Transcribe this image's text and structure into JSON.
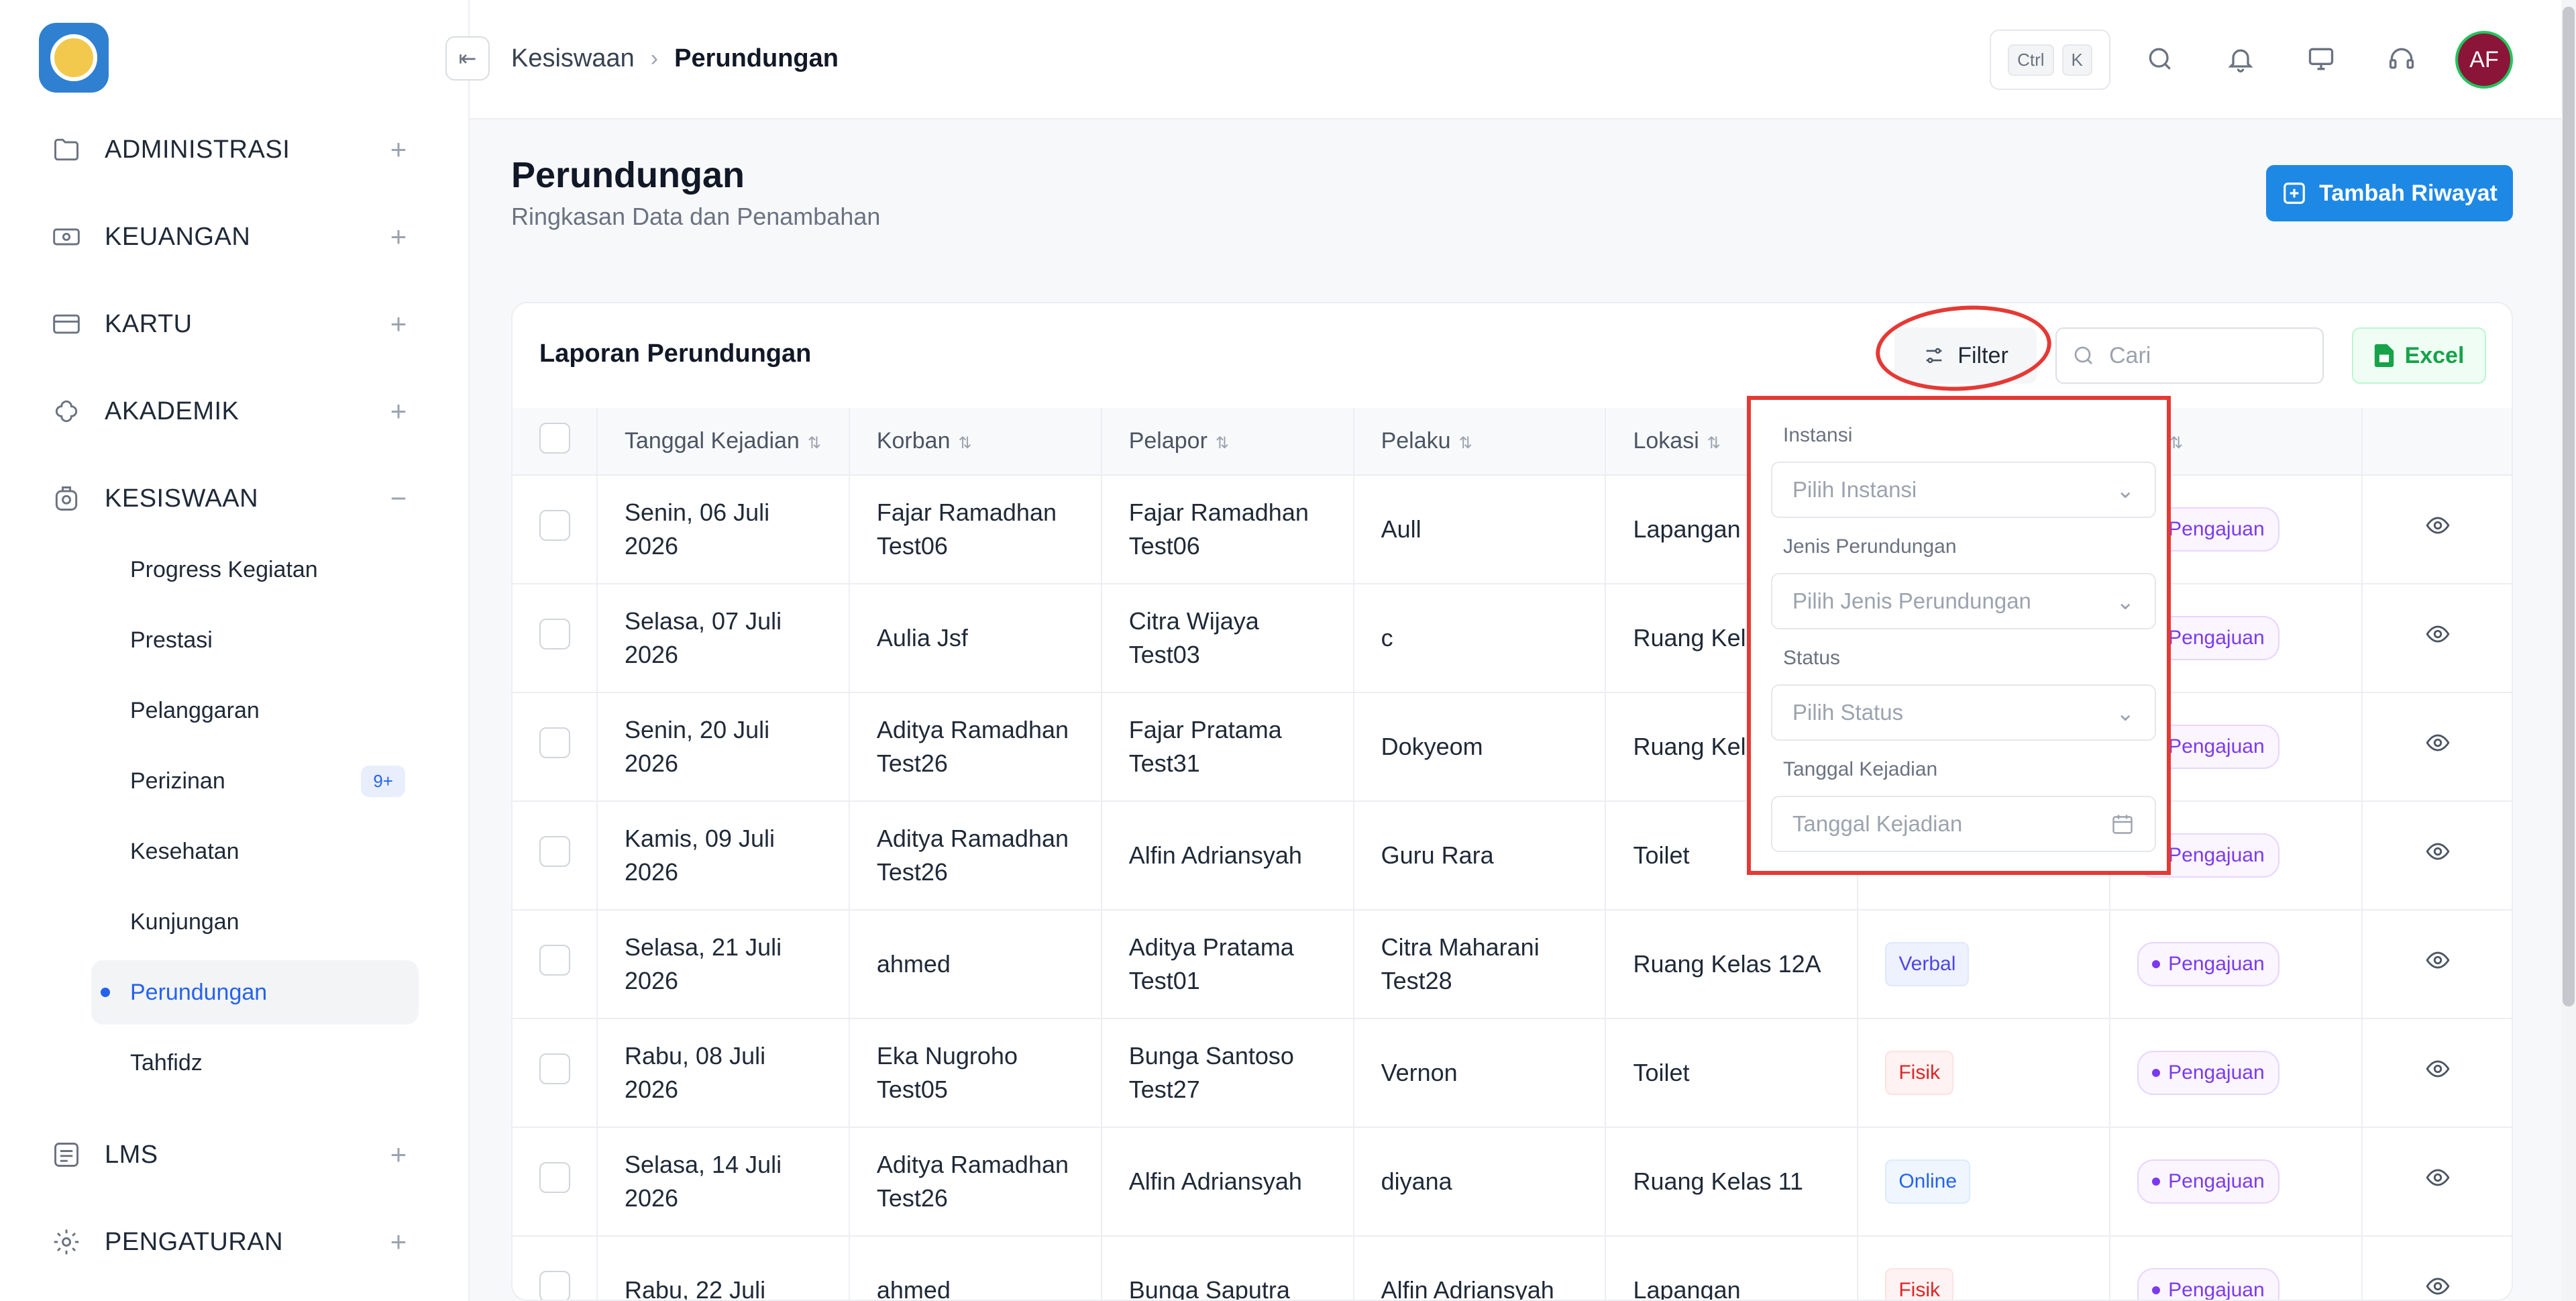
{
  "sidebar": {
    "menu": [
      {
        "label": "ADMINISTRASI",
        "toggle": "+",
        "icon": "folder-icon"
      },
      {
        "label": "KEUANGAN",
        "toggle": "+",
        "icon": "money-icon"
      },
      {
        "label": "KARTU",
        "toggle": "+",
        "icon": "card-icon"
      },
      {
        "label": "AKADEMIK",
        "toggle": "+",
        "icon": "brain-icon"
      },
      {
        "label": "KESISWAAN",
        "toggle": "−",
        "icon": "student-icon"
      }
    ],
    "kesiswaan_items": [
      {
        "label": "Progress Kegiatan"
      },
      {
        "label": "Prestasi"
      },
      {
        "label": "Pelanggaran"
      },
      {
        "label": "Perizinan",
        "badge": "9+"
      },
      {
        "label": "Kesehatan"
      },
      {
        "label": "Kunjungan"
      },
      {
        "label": "Perundungan"
      },
      {
        "label": "Tahfidz"
      }
    ],
    "bottom_menu": [
      {
        "label": "LMS",
        "toggle": "+",
        "icon": "list-icon"
      },
      {
        "label": "PENGATURAN",
        "toggle": "+",
        "icon": "gear-icon"
      }
    ]
  },
  "header": {
    "breadcrumb_parent": "Kesiswaan",
    "breadcrumb_current": "Perundungan",
    "shortcut_ctrl": "Ctrl",
    "shortcut_key": "K",
    "avatar_initials": "AF"
  },
  "page": {
    "title": "Perundungan",
    "subtitle": "Ringkasan Data dan Penambahan",
    "add_button": "Tambah Riwayat"
  },
  "card": {
    "title": "Laporan Perundungan",
    "filter_label": "Filter",
    "search_placeholder": "Cari",
    "excel_label": "Excel"
  },
  "table": {
    "columns": [
      "Tanggal Kejadian",
      "Korban",
      "Pelapor",
      "Pelaku",
      "Lokasi",
      "",
      "us"
    ],
    "rows": [
      {
        "date": [
          "Senin, 06 Juli",
          "2026"
        ],
        "korban": [
          "Fajar Ramadhan",
          "Test06"
        ],
        "pelapor": [
          "Fajar Ramadhan",
          "Test06"
        ],
        "pelaku": [
          "Aull"
        ],
        "lokasi": "Lapangan",
        "jenis": "",
        "status": "Pengajuan"
      },
      {
        "date": [
          "Selasa, 07 Juli",
          "2026"
        ],
        "korban": [
          "Aulia Jsf"
        ],
        "pelapor": [
          "Citra Wijaya",
          "Test03"
        ],
        "pelaku": [
          "c"
        ],
        "lokasi": "Ruang Kela",
        "jenis": "",
        "status": "Pengajuan"
      },
      {
        "date": [
          "Senin, 20 Juli",
          "2026"
        ],
        "korban": [
          "Aditya Ramadhan",
          "Test26"
        ],
        "pelapor": [
          "Fajar Pratama",
          "Test31"
        ],
        "pelaku": [
          "Dokyeom"
        ],
        "lokasi": "Ruang Kela",
        "jenis": "",
        "status": "Pengajuan"
      },
      {
        "date": [
          "Kamis, 09 Juli",
          "2026"
        ],
        "korban": [
          "Aditya Ramadhan",
          "Test26"
        ],
        "pelapor": [
          "Alfin Adriansyah"
        ],
        "pelaku": [
          "Guru Rara"
        ],
        "lokasi": "Toilet",
        "jenis": "",
        "status": "Pengajuan"
      },
      {
        "date": [
          "Selasa, 21 Juli",
          "2026"
        ],
        "korban": [
          "ahmed"
        ],
        "pelapor": [
          "Aditya Pratama",
          "Test01"
        ],
        "pelaku": [
          "Citra Maharani",
          "Test28"
        ],
        "lokasi": "Ruang Kelas 12A",
        "jenis": "Verbal",
        "status": "Pengajuan"
      },
      {
        "date": [
          "Rabu, 08 Juli",
          "2026"
        ],
        "korban": [
          "Eka Nugroho",
          "Test05"
        ],
        "pelapor": [
          "Bunga Santoso",
          "Test27"
        ],
        "pelaku": [
          "Vernon"
        ],
        "lokasi": "Toilet",
        "jenis": "Fisik",
        "status": "Pengajuan"
      },
      {
        "date": [
          "Selasa, 14 Juli",
          "2026"
        ],
        "korban": [
          "Aditya Ramadhan",
          "Test26"
        ],
        "pelapor": [
          "Alfin Adriansyah"
        ],
        "pelaku": [
          "diyana"
        ],
        "lokasi": "Ruang Kelas 11",
        "jenis": "Online",
        "status": "Pengajuan"
      },
      {
        "date": [
          "Rabu, 22 Juli",
          ""
        ],
        "korban": [
          "ahmed"
        ],
        "pelapor": [
          "Bunga Saputra"
        ],
        "pelaku": [
          "Alfin Adriansyah"
        ],
        "lokasi": "Lapangan",
        "jenis": "Fisik",
        "status": "Pengajuan"
      }
    ]
  },
  "filter_popover": {
    "instansi_label": "Instansi",
    "instansi_placeholder": "Pilih Instansi",
    "jenis_label": "Jenis Perundungan",
    "jenis_placeholder": "Pilih Jenis Perundungan",
    "status_label": "Status",
    "status_placeholder": "Pilih Status",
    "tanggal_label": "Tanggal Kejadian",
    "tanggal_placeholder": "Tanggal Kejadian"
  },
  "colors": {
    "primary": "#1e88e5",
    "annotation_red": "#e53935",
    "status_purple": "#7c3aed",
    "excel_green": "#16a34a"
  }
}
